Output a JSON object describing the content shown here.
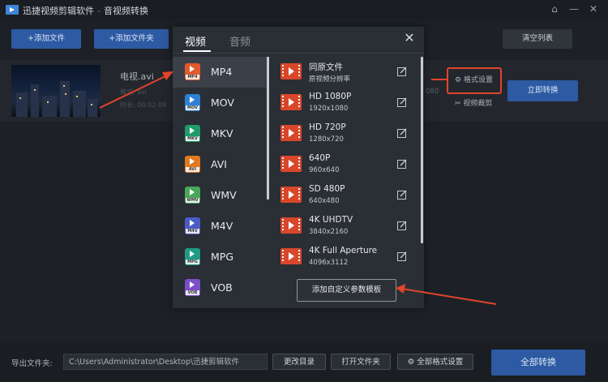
{
  "app": {
    "title": "迅捷视频剪辑软件",
    "subtitle": "音视频转换",
    "title_sep": "-"
  },
  "window_controls": [
    "home-icon",
    "minimize-icon",
    "close-icon"
  ],
  "toolbar": {
    "add_file": "+添加文件",
    "add_folder": "+添加文件夹",
    "clear_list": "清空列表"
  },
  "file": {
    "name": "电视.avi",
    "meta1": "格式: avi",
    "meta2": "时长: 00:02:09",
    "resolution_hint": "080",
    "format_settings": "格式设置",
    "video_clip": "视频裁剪",
    "convert_now": "立即转换"
  },
  "dialog": {
    "tabs": [
      "视频",
      "音频"
    ],
    "active_tab": "视频",
    "formats": [
      {
        "name": "MP4",
        "tag": "MP4",
        "color": "#e05a2b",
        "selected": true
      },
      {
        "name": "MOV",
        "tag": "MOV",
        "color": "#2f7fd6",
        "selected": false
      },
      {
        "name": "MKV",
        "tag": "MKV",
        "color": "#1f9a6b",
        "selected": false
      },
      {
        "name": "AVI",
        "tag": "AVI",
        "color": "#e07a22",
        "selected": false
      },
      {
        "name": "WMV",
        "tag": "WMV",
        "color": "#4aa65a",
        "selected": false
      },
      {
        "name": "M4V",
        "tag": "M4V",
        "color": "#4b5bc4",
        "selected": false
      },
      {
        "name": "MPG",
        "tag": "MPG",
        "color": "#1f9a86",
        "selected": false
      },
      {
        "name": "VOB",
        "tag": "VOB",
        "color": "#7b4fc9",
        "selected": false
      }
    ],
    "presets": [
      {
        "name": "同原文件",
        "sub": "原视频分辨率"
      },
      {
        "name": "HD 1080P",
        "sub": "1920x1080"
      },
      {
        "name": "HD 720P",
        "sub": "1280x720"
      },
      {
        "name": "640P",
        "sub": "960x640"
      },
      {
        "name": "SD 480P",
        "sub": "640x480"
      },
      {
        "name": "4K UHDTV",
        "sub": "3840x2160"
      },
      {
        "name": "4K Full Aperture",
        "sub": "4096x3112"
      }
    ],
    "custom_button": "添加自定义参数模板"
  },
  "bottom": {
    "output_label": "导出文件夹:",
    "output_path": "C:\\Users\\Administrator\\Desktop\\迅捷剪辑软件",
    "change_dir": "更改目录",
    "open_folder": "打开文件夹",
    "all_settings": "全部格式设置",
    "convert_all": "全部转换"
  },
  "colors": {
    "accent_blue": "#2d5aa3",
    "highlight_red": "#e0442c",
    "preset_orange": "#d9472b"
  }
}
